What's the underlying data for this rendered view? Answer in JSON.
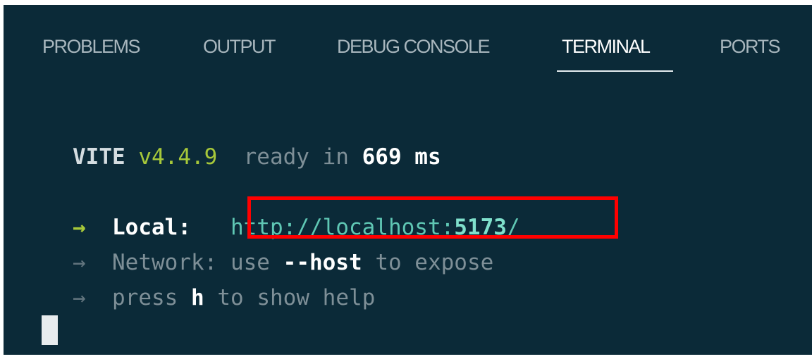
{
  "tabs": [
    {
      "label": "PROBLEMS",
      "active": false
    },
    {
      "label": "OUTPUT",
      "active": false
    },
    {
      "label": "DEBUG CONSOLE",
      "active": false
    },
    {
      "label": "TERMINAL",
      "active": true
    },
    {
      "label": "PORTS",
      "active": false
    }
  ],
  "terminal": {
    "vite_name": "VITE",
    "vite_version": "v4.4.9",
    "ready_prefix": "ready in",
    "ready_ms": "669",
    "ready_unit": "ms",
    "arrow": "→",
    "local_label": "Local:",
    "local_url_prefix": "http://localhost:",
    "local_url_port": "5173",
    "local_url_suffix": "/",
    "network_label": "Network:",
    "network_pre": "use",
    "network_flag": "--host",
    "network_post": "to expose",
    "help_pre": "press",
    "help_key": "h",
    "help_post": "to show help"
  },
  "colors": {
    "background": "#0b2a38",
    "highlight_box": "#ff0000",
    "version_green": "#a7c83a",
    "url_teal": "#5fc7b4"
  }
}
